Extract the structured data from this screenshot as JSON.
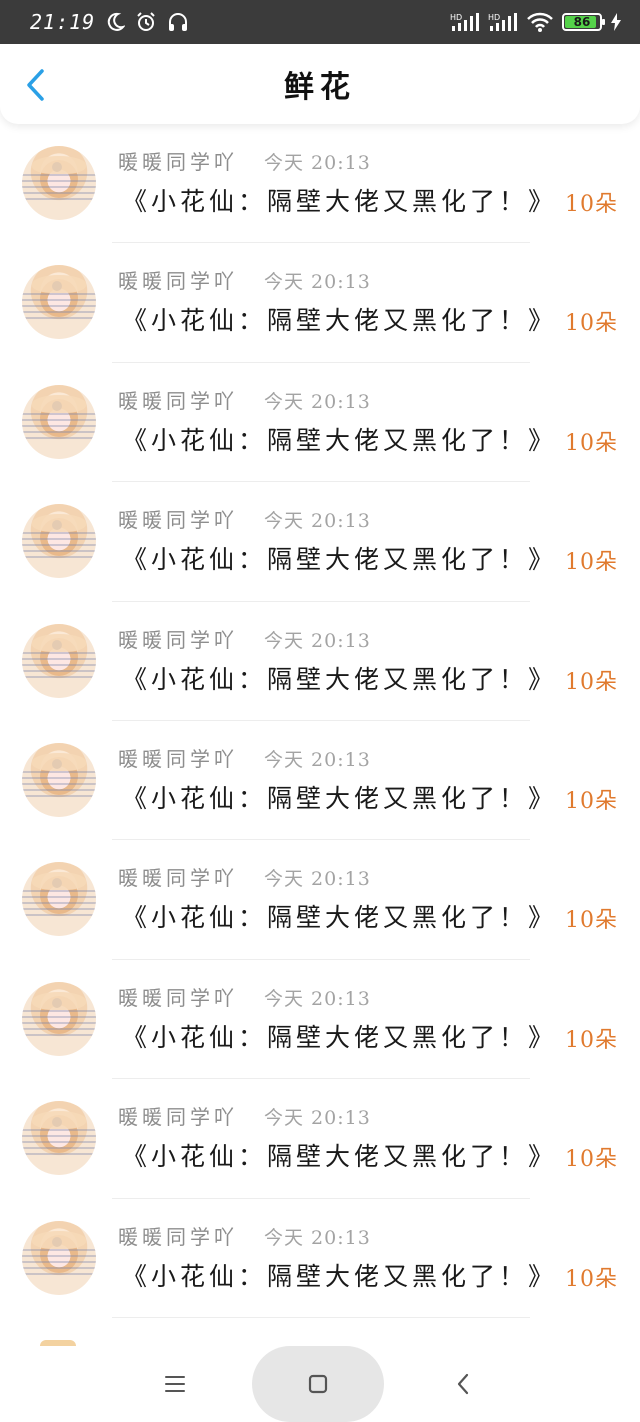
{
  "status_bar": {
    "time": "21:19",
    "net1": "HD",
    "net2": "HD",
    "battery": "86",
    "icons": [
      "moon-icon",
      "alarm-icon",
      "headphones-icon",
      "signal-icon",
      "wifi-icon",
      "battery-icon",
      "charging-icon"
    ]
  },
  "header": {
    "title": "鲜花",
    "back_icon": "chevron-left-icon"
  },
  "list": [
    {
      "name": "暖暖同学吖",
      "time": "今天 20:13",
      "book": "《小花仙：隔壁大佬又黑化了！》",
      "count": "10朵"
    },
    {
      "name": "暖暖同学吖",
      "time": "今天 20:13",
      "book": "《小花仙：隔壁大佬又黑化了！》",
      "count": "10朵"
    },
    {
      "name": "暖暖同学吖",
      "time": "今天 20:13",
      "book": "《小花仙：隔壁大佬又黑化了！》",
      "count": "10朵"
    },
    {
      "name": "暖暖同学吖",
      "time": "今天 20:13",
      "book": "《小花仙：隔壁大佬又黑化了！》",
      "count": "10朵"
    },
    {
      "name": "暖暖同学吖",
      "time": "今天 20:13",
      "book": "《小花仙：隔壁大佬又黑化了！》",
      "count": "10朵"
    },
    {
      "name": "暖暖同学吖",
      "time": "今天 20:13",
      "book": "《小花仙：隔壁大佬又黑化了！》",
      "count": "10朵"
    },
    {
      "name": "暖暖同学吖",
      "time": "今天 20:13",
      "book": "《小花仙：隔壁大佬又黑化了！》",
      "count": "10朵"
    },
    {
      "name": "暖暖同学吖",
      "time": "今天 20:13",
      "book": "《小花仙：隔壁大佬又黑化了！》",
      "count": "10朵"
    },
    {
      "name": "暖暖同学吖",
      "time": "今天 20:13",
      "book": "《小花仙：隔壁大佬又黑化了！》",
      "count": "10朵"
    },
    {
      "name": "暖暖同学吖",
      "time": "今天 20:13",
      "book": "《小花仙：隔壁大佬又黑化了！》",
      "count": "10朵"
    }
  ],
  "nav_bar": {
    "icons": [
      "menu-icon",
      "home-square-icon",
      "back-chevron-icon"
    ]
  },
  "colors": {
    "accent_blue": "#2aa0e6",
    "flower_count": "#e07a2e",
    "status_bar_bg": "#3b3b3b",
    "battery_green": "#55d24a"
  }
}
